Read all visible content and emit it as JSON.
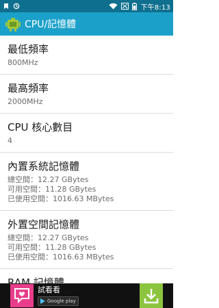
{
  "status_bar": {
    "time": "下午8:13",
    "left_icons": [
      "notification-icon",
      "sync-icon"
    ],
    "right_icons": [
      "wifi-icon",
      "no-signal-icon",
      "battery-icon"
    ]
  },
  "app_bar": {
    "title": "CPU/記憶體",
    "icon": "android-icon"
  },
  "items": [
    {
      "title": "最低頻率",
      "value": "800MHz"
    },
    {
      "title": "最高頻率",
      "value": "2000MHz"
    },
    {
      "title": "CPU 核心數目",
      "value": "4"
    },
    {
      "title": "內置系統記憶體",
      "lines": [
        "總空間：12.27 GBytes",
        "可用空間：11.28 GBytes",
        "已使用空間：1016.63 MBytes"
      ]
    },
    {
      "title": "外置空間記憶體",
      "lines": [
        "總空間：12.27 GBytes",
        "可用空間：11.28 GBytes",
        "已使用空間：1016.63 MBytes"
      ]
    },
    {
      "title": "RAM 記憶體"
    }
  ],
  "ad": {
    "title": "試看看",
    "store_label": "Google play"
  },
  "colors": {
    "status_bar": "#0f6f8e",
    "app_bar": "#1ba1c9",
    "ad_logo": "#e83d8b",
    "download": "#8cc43f"
  }
}
